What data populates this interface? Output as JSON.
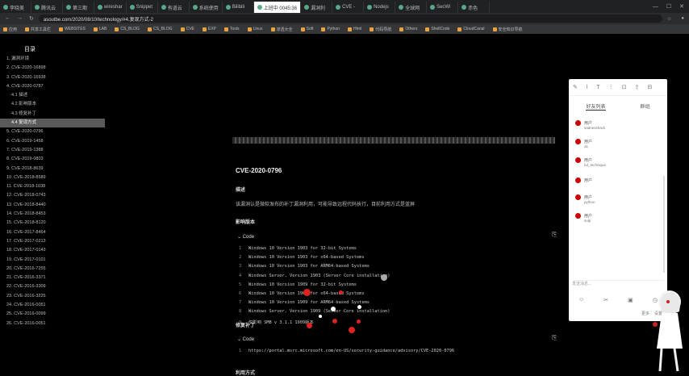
{
  "browser": {
    "tabs": [
      {
        "label": "李晓美"
      },
      {
        "label": "腾讯云"
      },
      {
        "label": "第三期"
      },
      {
        "label": "wireshar"
      },
      {
        "label": "Snippet"
      },
      {
        "label": "有道云"
      },
      {
        "label": "系统使用"
      },
      {
        "label": "Bilibili"
      },
      {
        "label": "上班中 0045:36",
        "active": true
      },
      {
        "label": "漏洞利"
      },
      {
        "label": "CVE -"
      },
      {
        "label": "Nodejs"
      },
      {
        "label": "全球网"
      },
      {
        "label": "SecWi"
      },
      {
        "label": "赤色"
      }
    ],
    "url": "asoutbe.com/2020/08/10/technology/#4.复现方式-2",
    "nav_icons": [
      "back-icon",
      "forward-icon",
      "reload-icon"
    ],
    "window_controls": [
      "—",
      "☐",
      "✕"
    ],
    "bookmarks": [
      "应用",
      "共享工具栏",
      "WEBSITES",
      "LAB",
      "CS_BLOG",
      "CS_BLOG",
      "CVE",
      "EXP",
      "Tools",
      "Linux",
      "渗透大全",
      "Soft",
      "Python",
      "Html",
      "代码导航",
      "Others",
      "ShellCode",
      "CloudCanal",
      "安全知识导航"
    ]
  },
  "toc": {
    "title": "目录",
    "items": [
      {
        "label": "1. 漏洞环境"
      },
      {
        "label": "2. CVE-2020-16898"
      },
      {
        "label": "3. CVE-2020-16938"
      },
      {
        "label": "4. CVE-2020-0787"
      },
      {
        "label": "4.1 描述",
        "sub": true
      },
      {
        "label": "4.2 影响版本",
        "sub": true
      },
      {
        "label": "4.3 修复补丁",
        "sub": true
      },
      {
        "label": "4.4 复现方式",
        "sub": true,
        "active": true
      },
      {
        "label": "5. CVE-2020-0796"
      },
      {
        "label": "6. CVE-2019-1458"
      },
      {
        "label": "7. CVE-2019-1388"
      },
      {
        "label": "8. CVE-2019-0803"
      },
      {
        "label": "9. CVE-2018-8639"
      },
      {
        "label": "10. CVE-2018-8589"
      },
      {
        "label": "11. CVE-2018-1038"
      },
      {
        "label": "12. CVE-2018-0743"
      },
      {
        "label": "13. CVE-2018-8440"
      },
      {
        "label": "14. CVE-2018-8453"
      },
      {
        "label": "15. CVE-2018-8120"
      },
      {
        "label": "16. CVE-2017-8464"
      },
      {
        "label": "17. CVE-2017-0213"
      },
      {
        "label": "18. CVE-2017-0143"
      },
      {
        "label": "19. CVE-2017-0101"
      },
      {
        "label": "20. CVE-2016-7255"
      },
      {
        "label": "21. CVE-2016-3371"
      },
      {
        "label": "22. CVE-2016-3309"
      },
      {
        "label": "23. CVE-2016-3225"
      },
      {
        "label": "24. CVE-2016-0051"
      },
      {
        "label": "25. CVE-2016-0099"
      },
      {
        "label": "26. CVE-2016-0051"
      }
    ]
  },
  "article": {
    "cve_title": "CVE-2020-0796",
    "desc_label": "描述",
    "desc_text": "该漏洞认是微软发布的补丁漏洞利用，可能导致远程代码执行，目前利用方式是蓝屏",
    "affected_label": "影响版本",
    "code_label": "Code",
    "code_lines": [
      "Windows 10 Version 1903 for 32-bit Systems",
      "Windows 10 Version 1903 for x64-based Systems",
      "Windows 10 Version 1903 for ARM64-based Systems",
      "Windows Server, Version 1903 (Server Core installation)",
      "Windows 10 Version 1909 for 32-bit Systems",
      "Windows 10 Version 1909 for x64-based Systems",
      "Windows 10 Version 1909 for ARM64-based Systems",
      "Windows Server, Version 1909 (Server Core installation)",
      "仅影响 SMB v 3.1.1 1909版本"
    ],
    "patch_label": "修复补丁",
    "patch_code_label": "Code",
    "patch_line": "https://portal.msrc.microsoft.com/en-US/security-guidance/advisory/CVE-2020-0796",
    "exploit_label": "利用方式"
  },
  "chat_panel": {
    "tabs": [
      "好友列表",
      "群组"
    ],
    "contacts": [
      {
        "name": "用户",
        "sub": "sadnesshack"
      },
      {
        "name": "用户",
        "sub": "a1"
      },
      {
        "name": "用户",
        "sub": "hd_technique"
      },
      {
        "name": "用户",
        "sub": ""
      },
      {
        "name": "用户",
        "sub": "python"
      },
      {
        "name": "用户",
        "sub": "sulp"
      }
    ],
    "composer": "发送消息...",
    "footer": [
      "更多",
      "设置"
    ]
  },
  "colors": {
    "background": "#000000",
    "toc_active": "#5a5a5a",
    "avatar": "#cc0000",
    "accent_red": "#dd2222"
  }
}
